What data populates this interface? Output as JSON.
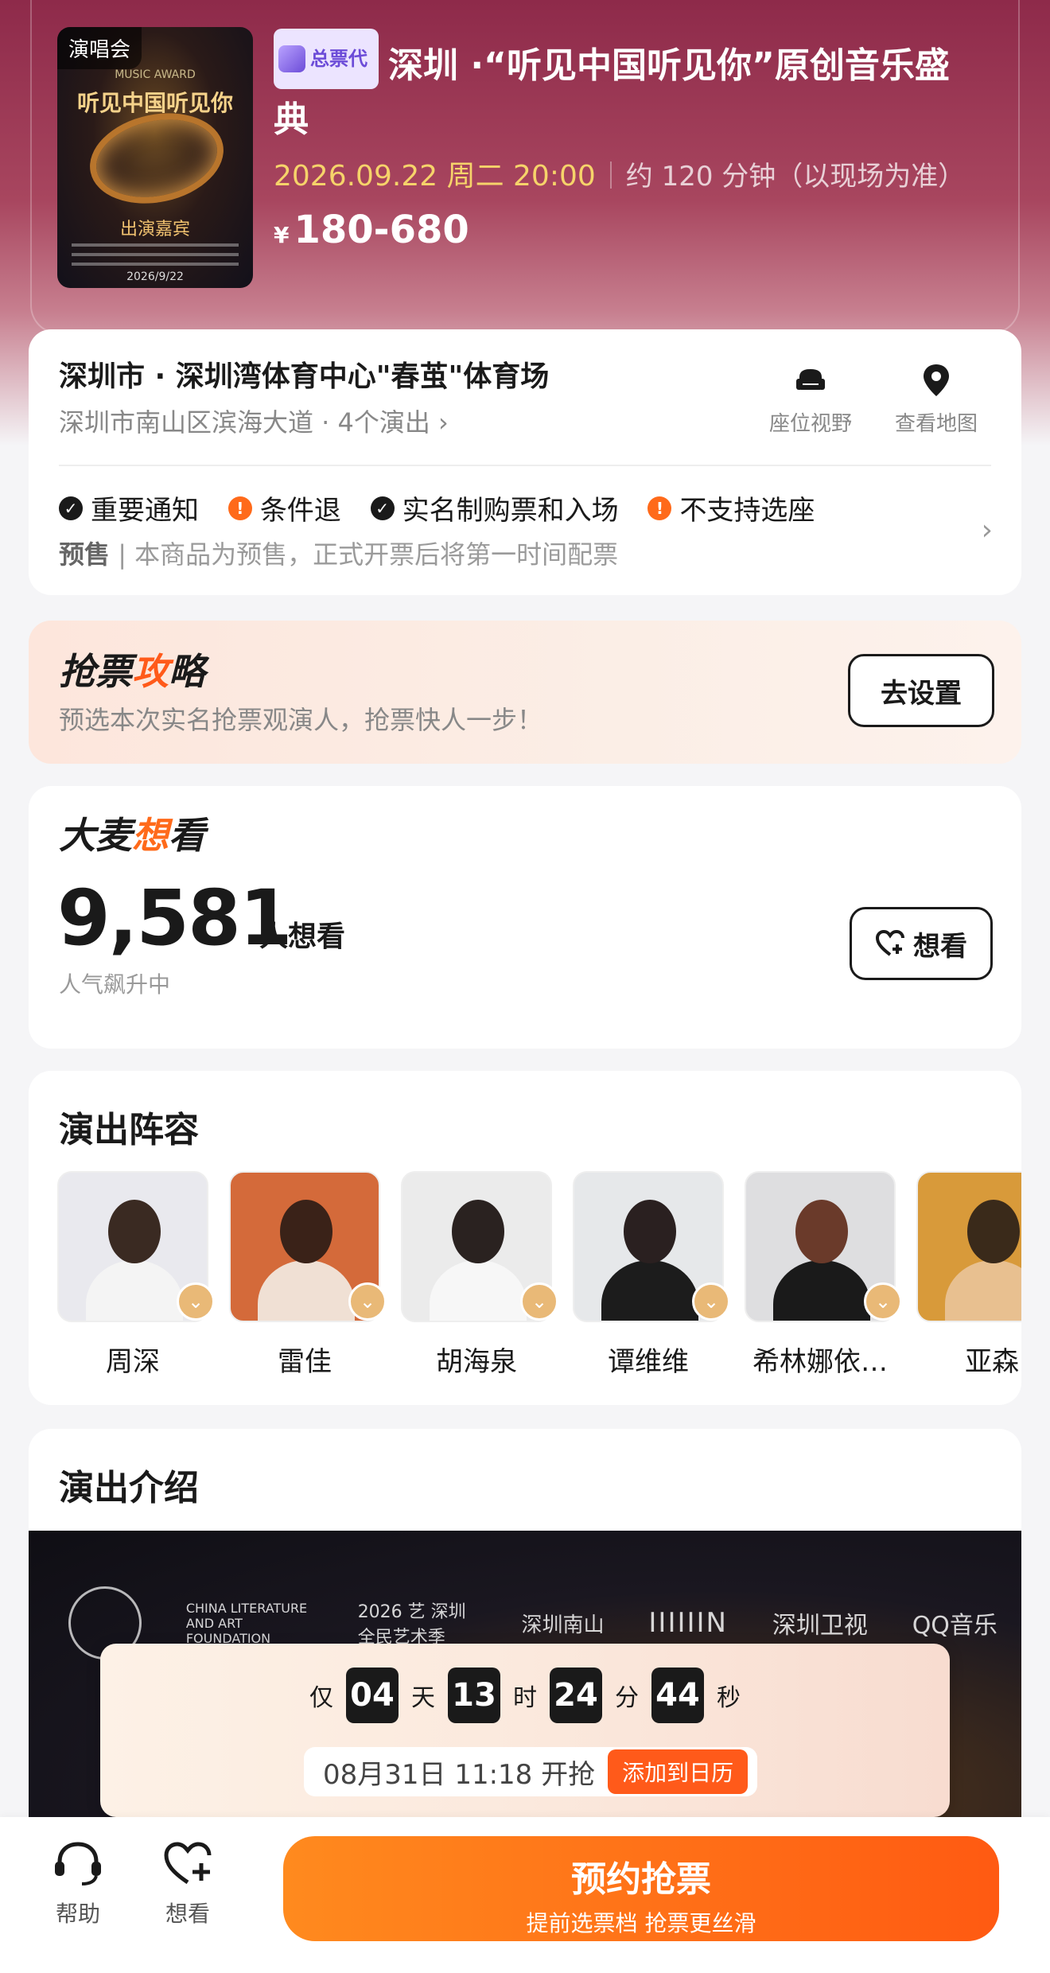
{
  "event": {
    "category_tag": "演唱会",
    "agent_badge": "总票代",
    "title": "深圳 ·“听见中国听见你”原创音乐盛典",
    "datetime": "2026.09.22 周二 20:00",
    "duration": "约 120 分钟（以现场为准）",
    "price_symbol": "¥",
    "price_range": "180-680",
    "poster_text": {
      "top": "MUSIC AWARD",
      "title": "听见中国听见你",
      "guests": "出演嘉宾",
      "date": "2026/9/22"
    }
  },
  "venue": {
    "name": "深圳市 · 深圳湾体育中心\"春茧\"体育场",
    "address": "深圳市南山区滨海大道 · 4个演出 ›",
    "seat_view_label": "座位视野",
    "map_label": "查看地图"
  },
  "notices": [
    {
      "label": "重要通知",
      "status": "ok"
    },
    {
      "label": "条件退",
      "status": "warn"
    },
    {
      "label": "实名制购票和入场",
      "status": "ok"
    },
    {
      "label": "不支持选座",
      "status": "warn"
    }
  ],
  "presale": {
    "tag": "预售",
    "text": "| 本商品为预售，正式开票后将第一时间配票"
  },
  "strategy": {
    "title_a": "抢票",
    "title_b": "攻",
    "title_c": "略",
    "subtitle": "预选本次实名抢票观演人，抢票快人一步！",
    "button": "去设置"
  },
  "wishlist": {
    "title_a": "大麦",
    "title_b": "想",
    "title_c": "看",
    "count": "9,581",
    "unit": "人想看",
    "trend": "人气飙升中",
    "button": "想看"
  },
  "cast": {
    "title": "演出阵容",
    "members": [
      {
        "name": "周深",
        "bg": "#e9e9ee",
        "head": "#3a2a22",
        "body": "#f4f4f4"
      },
      {
        "name": "雷佳",
        "bg": "#d46a3a",
        "head": "#3a2218",
        "body": "#f0e0d4"
      },
      {
        "name": "胡海泉",
        "bg": "#ebebeb",
        "head": "#2a2220",
        "body": "#f7f7f7"
      },
      {
        "name": "谭维维",
        "bg": "#e6e8ea",
        "head": "#2a2020",
        "body": "#1c1c1c"
      },
      {
        "name": "希林娜依…",
        "bg": "#dedee0",
        "head": "#6a3a2a",
        "body": "#1a1a1a"
      },
      {
        "name": "亚森",
        "bg": "#d89a3a",
        "head": "#3a2a1a",
        "body": "#e8c090"
      }
    ]
  },
  "intro": {
    "title": "演出介绍",
    "logos": [
      "CHINA LITERATURE AND ART FOUNDATION",
      "2026 艺 深圳全民艺术季",
      "深圳南山",
      "IIIIIIN",
      "深圳卫视",
      "QQ音乐"
    ]
  },
  "countdown": {
    "prefix": "仅",
    "days": "04",
    "days_label": "天",
    "hours": "13",
    "hours_label": "时",
    "minutes": "24",
    "minutes_label": "分",
    "seconds": "44",
    "seconds_label": "秒",
    "start_text": "08月31日 11:18 开抢",
    "calendar_button": "添加到日历"
  },
  "bottom": {
    "help": "帮助",
    "want": "想看",
    "cta_title": "预约抢票",
    "cta_sub": "提前选票档 抢票更丝滑"
  },
  "colors": {
    "accent": "#ff5a1a",
    "hero": "#8e2a4a",
    "price_date": "#f6d36a"
  }
}
